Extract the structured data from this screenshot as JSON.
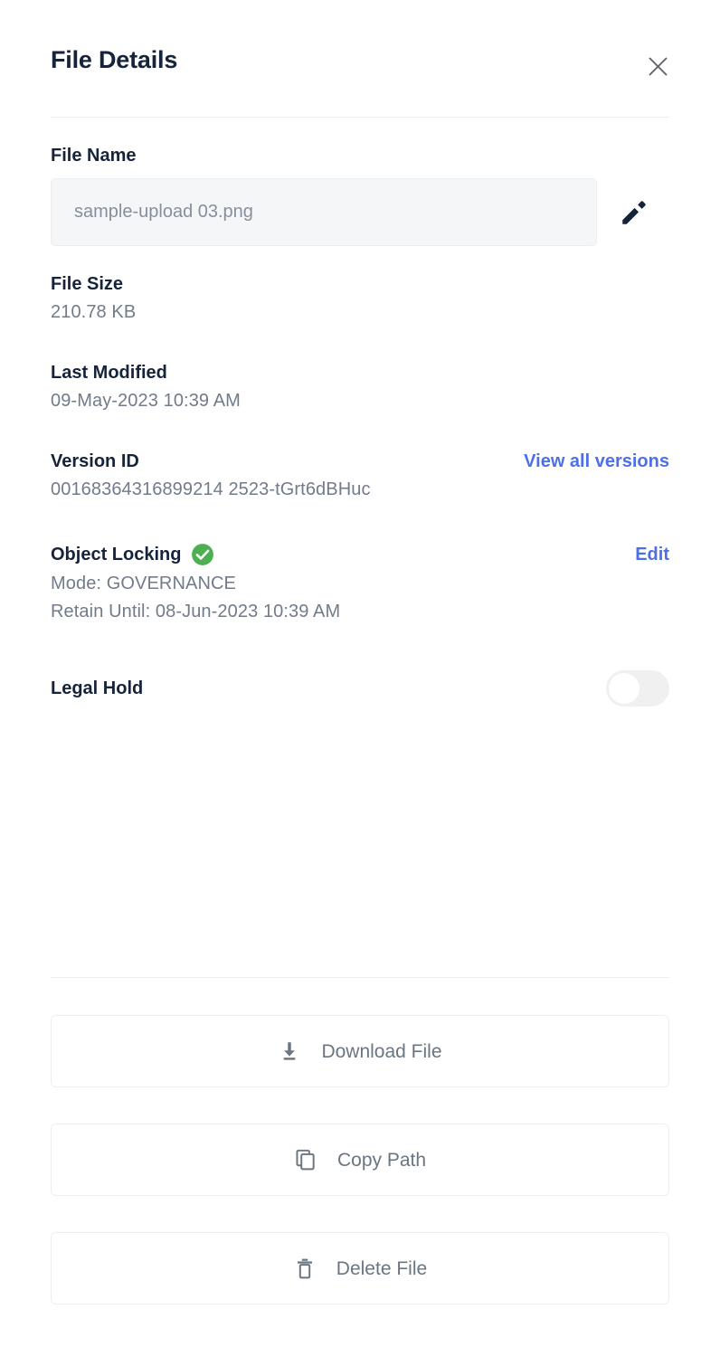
{
  "header": {
    "title": "File Details",
    "close_icon": "close-icon"
  },
  "fields": {
    "file_name": {
      "label": "File Name",
      "value": "sample-upload 03.png",
      "edit_icon": "pencil-icon"
    },
    "file_size": {
      "label": "File Size",
      "value": "210.78 KB"
    },
    "last_modified": {
      "label": "Last Modified",
      "value": "09-May-2023 10:39 AM"
    },
    "version_id": {
      "label": "Version ID",
      "value": "00168364316899214 2523-tGrt6dBHuc",
      "link_label": "View all versions"
    },
    "object_locking": {
      "label": "Object Locking",
      "status_icon": "check-circle-icon",
      "mode": "Mode: GOVERNANCE",
      "retain_until": "Retain Until: 08-Jun-2023 10:39 AM",
      "link_label": "Edit"
    },
    "legal_hold": {
      "label": "Legal Hold",
      "enabled": false
    }
  },
  "actions": [
    {
      "label": "Download File",
      "icon": "download-icon"
    },
    {
      "label": "Copy Path",
      "icon": "copy-icon"
    },
    {
      "label": "Delete File",
      "icon": "trash-icon"
    }
  ],
  "colors": {
    "title": "#15233b",
    "label": "#15233b",
    "value": "#717b8a",
    "link": "#4d70e8",
    "success": "#4caf50",
    "border": "#eceef0",
    "input_bg": "#f5f6f8"
  }
}
